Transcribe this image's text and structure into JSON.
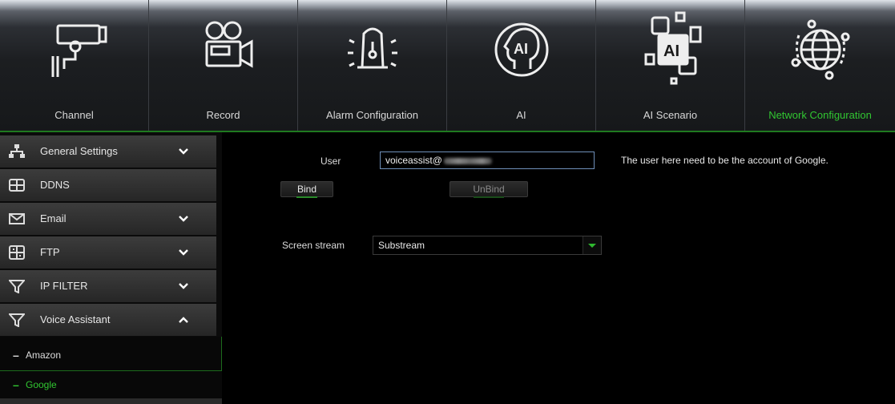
{
  "tabs": [
    {
      "label": "Channel",
      "icon": "camera-icon",
      "active": false
    },
    {
      "label": "Record",
      "icon": "video-recorder-icon",
      "active": false
    },
    {
      "label": "Alarm Configuration",
      "icon": "alarm-light-icon",
      "active": false
    },
    {
      "label": "AI",
      "icon": "ai-head-icon",
      "active": false
    },
    {
      "label": "AI Scenario",
      "icon": "ai-scenario-icon",
      "active": false
    },
    {
      "label": "Network Configuration",
      "icon": "globe-network-icon",
      "active": true
    }
  ],
  "sidebar": {
    "items": [
      {
        "label": "General Settings",
        "icon": "network-tree-icon",
        "chevron": "down"
      },
      {
        "label": "DDNS",
        "icon": "ddns-icon",
        "chevron": ""
      },
      {
        "label": "Email",
        "icon": "envelope-icon",
        "chevron": "down"
      },
      {
        "label": "FTP",
        "icon": "ftp-icon",
        "chevron": "down"
      },
      {
        "label": "IP FILTER",
        "icon": "funnel-icon",
        "chevron": "down"
      },
      {
        "label": "Voice Assistant",
        "icon": "funnel-icon",
        "chevron": "up"
      }
    ],
    "subitems": [
      {
        "label": "Amazon",
        "active": false
      },
      {
        "label": "Google",
        "active": true
      }
    ]
  },
  "form": {
    "user_label": "User",
    "user_value": "voiceassist@",
    "bind_label": "Bind",
    "unbind_label": "UnBind",
    "stream_label": "Screen stream",
    "stream_value": "Substream",
    "hint": "The user here need to be the account of Google."
  },
  "colors": {
    "accent_green": "#31c631",
    "input_border": "#6f8fb8"
  }
}
